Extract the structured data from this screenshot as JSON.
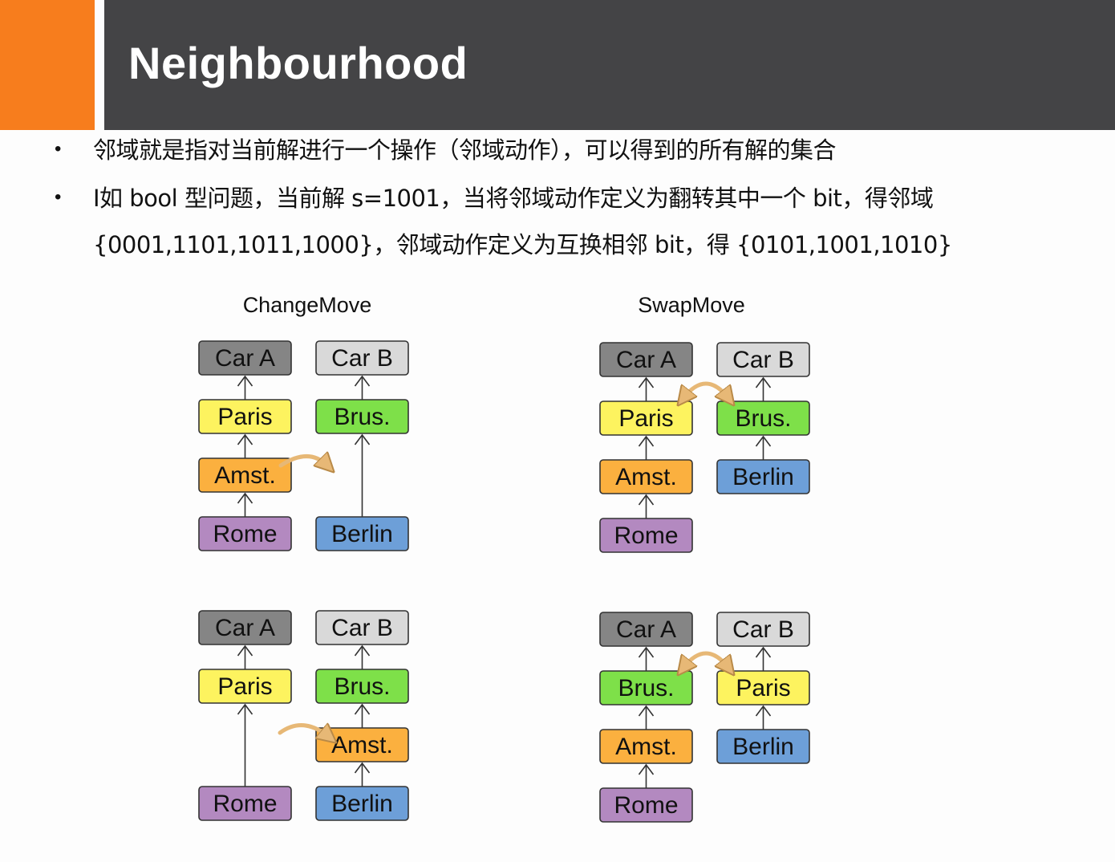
{
  "slide": {
    "title": "Neighbourhood",
    "bullets": [
      "邻域就是指对当前解进行一个操作（邻域动作），可以得到的所有解的集合",
      "I如 bool 型问题，当前解 s=1001，当将邻域动作定义为翻转其中一个 bit，得邻域 {0001,1101,1011,1000}，邻域动作定义为互换相邻 bit，得 {0101,1001,1010}"
    ]
  },
  "diagrams": {
    "change_move_label": "ChangeMove",
    "swap_move_label": "SwapMove",
    "colors": {
      "car": "#858585",
      "car_b": "#d9d9d9",
      "paris": "#fdf35f",
      "brussels": "#7ee049",
      "amsterdam": "#fbb03f",
      "rome": "#b389c0",
      "berlin": "#6d9fd8",
      "move_arrow": "#e7b876"
    },
    "panels": [
      {
        "name": "change-move-before",
        "columns": [
          [
            "Car A",
            "Paris",
            "Amst.",
            "Rome"
          ],
          [
            "Car B",
            "Brus.",
            "",
            "Berlin"
          ]
        ]
      },
      {
        "name": "swap-move-before",
        "columns": [
          [
            "Car A",
            "Paris",
            "Amst.",
            "Rome"
          ],
          [
            "Car B",
            "Brus.",
            "Berlin"
          ]
        ]
      },
      {
        "name": "change-move-after",
        "columns": [
          [
            "Car A",
            "Paris",
            "",
            "Rome"
          ],
          [
            "Car B",
            "Brus.",
            "Amst.",
            "Berlin"
          ]
        ]
      },
      {
        "name": "swap-move-after",
        "columns": [
          [
            "Car A",
            "Brus.",
            "Amst.",
            "Rome"
          ],
          [
            "Car B",
            "Paris",
            "Berlin"
          ]
        ]
      }
    ]
  }
}
